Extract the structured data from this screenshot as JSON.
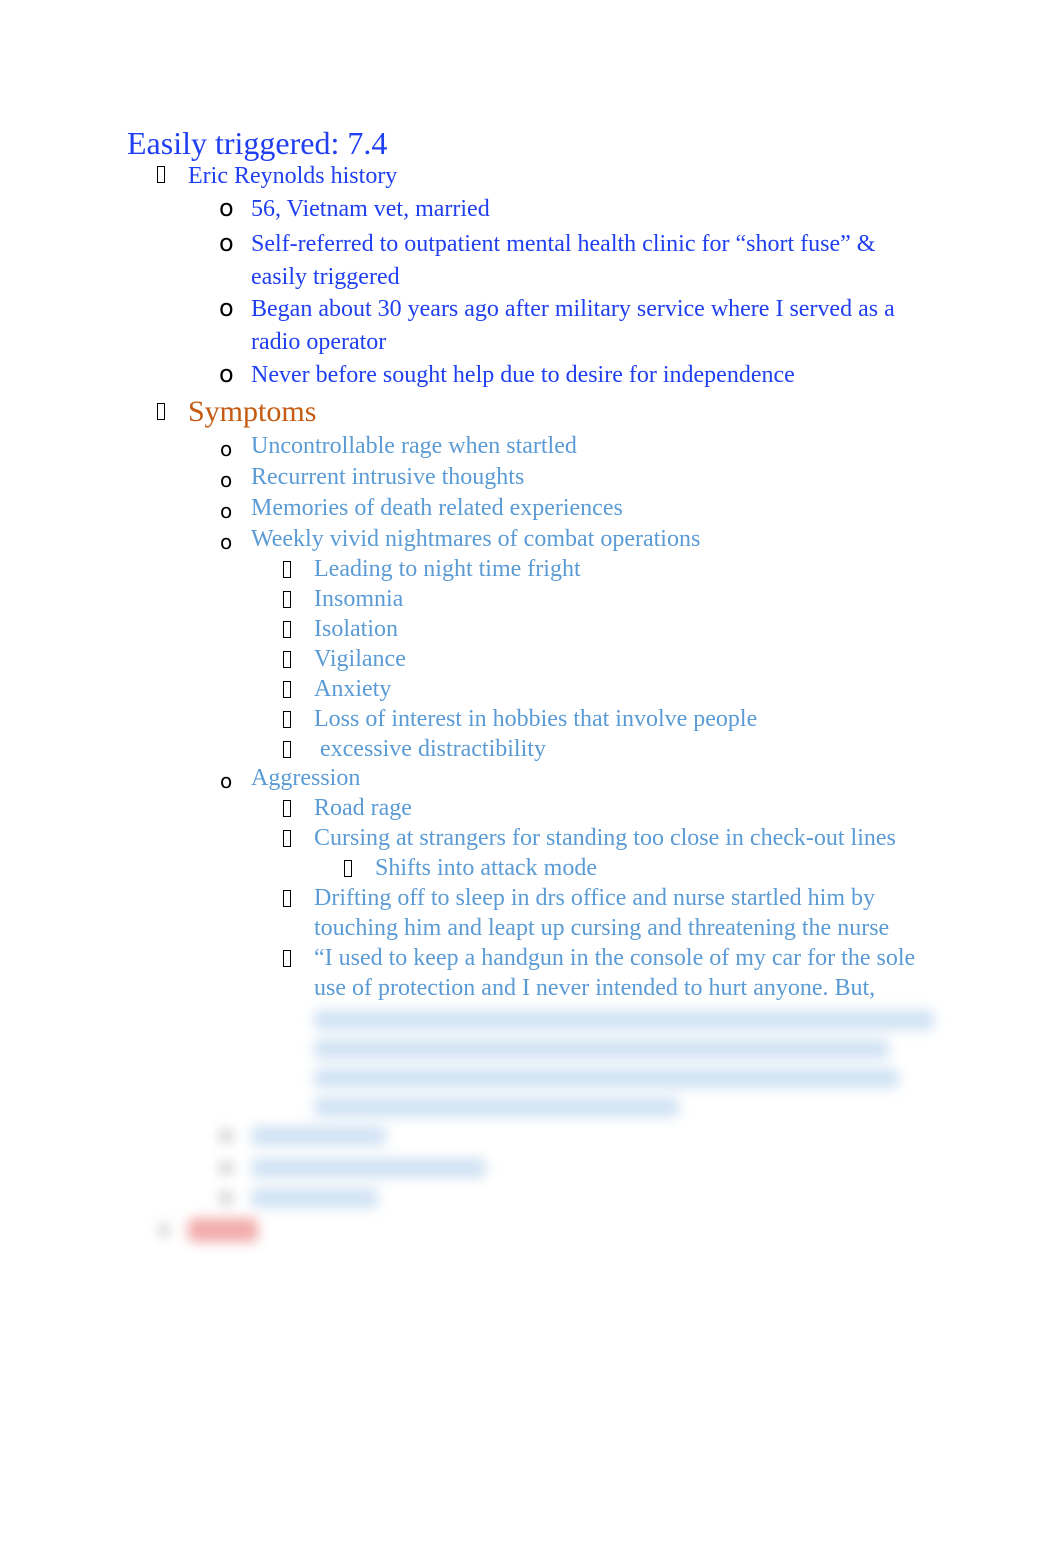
{
  "title": "Easily triggered: 7.4",
  "colors": {
    "heading": "#1f3ff0",
    "section": "#c55a11",
    "symptom_text": "#5b9bd5"
  },
  "history": {
    "label": "Eric Reynolds history",
    "items": [
      [
        "56, Vietnam vet, married"
      ],
      [
        "Self-referred to outpatient mental health clinic for “short fuse” &",
        "easily triggered"
      ],
      [
        "Began about 30 years ago after military service where I served as a",
        "radio operator"
      ],
      [
        "Never before sought help due to desire for independence"
      ]
    ]
  },
  "symptoms": {
    "label": "Symptoms",
    "items": [
      "Uncontrollable rage when startled",
      "Recurrent intrusive thoughts",
      "Memories of death related experiences",
      "Weekly vivid nightmares of combat operations"
    ],
    "nightmare_effects": [
      "Leading to night time fright",
      "Insomnia",
      "Isolation",
      "Vigilance",
      "Anxiety",
      "Loss of interest in hobbies that involve people",
      " excessive distractibility"
    ],
    "aggression": {
      "label": "Aggression",
      "items": [
        "Road rage",
        "Cursing at strangers for standing too close in check-out lines"
      ],
      "sub": "Shifts into attack mode",
      "more": [
        [
          "Drifting off to sleep in drs office and nurse startled him by",
          "touching him and leapt up cursing and threatening the nurse"
        ],
        [
          "“I used to keep a handgun in the console of my car for the sole",
          "use of protection and I never intended to hurt anyone. But,"
        ]
      ]
    }
  },
  "bullets": {
    "level1": "square-bullet-icon",
    "level2": "o",
    "level3": "square-bullet-icon"
  }
}
